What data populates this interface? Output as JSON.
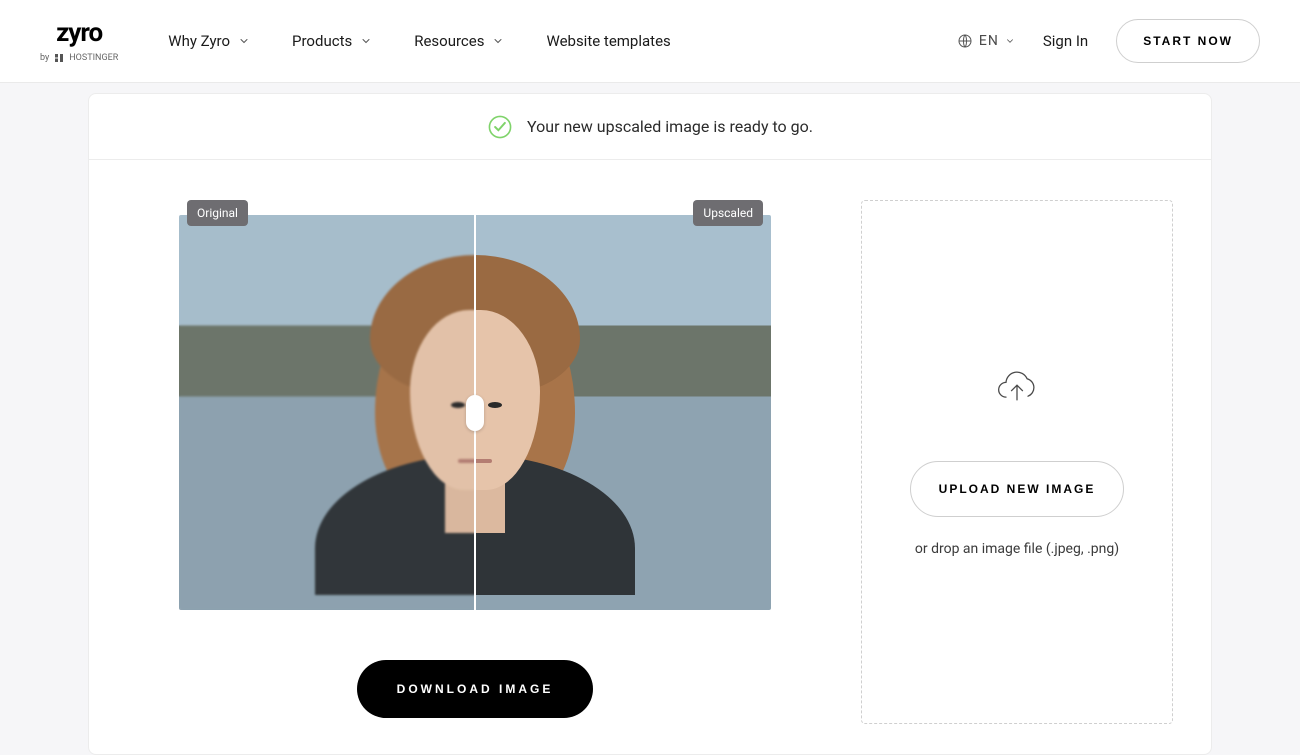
{
  "logo": {
    "main": "zyro",
    "subline_prefix": "by",
    "subline_brand": "HOSTINGER"
  },
  "nav": {
    "items": [
      {
        "label": "Why Zyro",
        "has_chevron": true
      },
      {
        "label": "Products",
        "has_chevron": true
      },
      {
        "label": "Resources",
        "has_chevron": true
      },
      {
        "label": "Website templates",
        "has_chevron": false
      }
    ],
    "language": "EN",
    "sign_in": "Sign In",
    "start_now": "START NOW"
  },
  "banner": {
    "message": "Your new upscaled image is ready to go."
  },
  "compare": {
    "original_label": "Original",
    "upscaled_label": "Upscaled"
  },
  "download_button": "DOWNLOAD IMAGE",
  "upload": {
    "button_label": "UPLOAD NEW IMAGE",
    "hint": "or drop an image file (.jpeg, .png)"
  }
}
